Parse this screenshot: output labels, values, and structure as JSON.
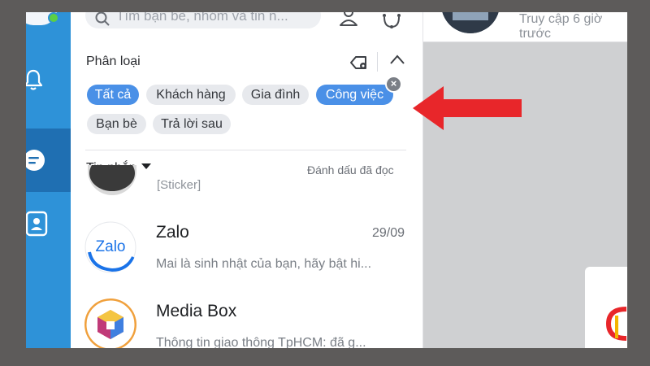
{
  "search": {
    "placeholder": "Tìm bạn bè, nhóm và tin n..."
  },
  "filter_panel": {
    "title": "Phân loại",
    "chips": [
      {
        "label": "Tất cả",
        "selected": true
      },
      {
        "label": "Khách hàng",
        "selected": false
      },
      {
        "label": "Gia đình",
        "selected": false
      },
      {
        "label": "Công việc",
        "selected": true
      },
      {
        "label": "Bạn bè",
        "selected": false
      },
      {
        "label": "Trả lời sau",
        "selected": false
      }
    ]
  },
  "inbox": {
    "filter_label": "Tin nhắn",
    "mark_all_read": "Đánh dấu đã đọc",
    "partial_preview": "[Sticker]",
    "conversations": [
      {
        "name": "Zalo",
        "time": "29/09",
        "preview": "Mai là sinh nhật của bạn, hãy bật hi...",
        "avatar_text": "Zalo"
      },
      {
        "name": "Media Box",
        "time": "",
        "preview": "Thông tin giao thông TpHCM: đã g..."
      }
    ]
  },
  "chat": {
    "last_access": "Truy cập 6 giờ trước"
  },
  "colors": {
    "accent": "#4a90e7",
    "sidebar": "#2e92d8",
    "arrow": "#e8262a",
    "online": "#5ccf45"
  }
}
